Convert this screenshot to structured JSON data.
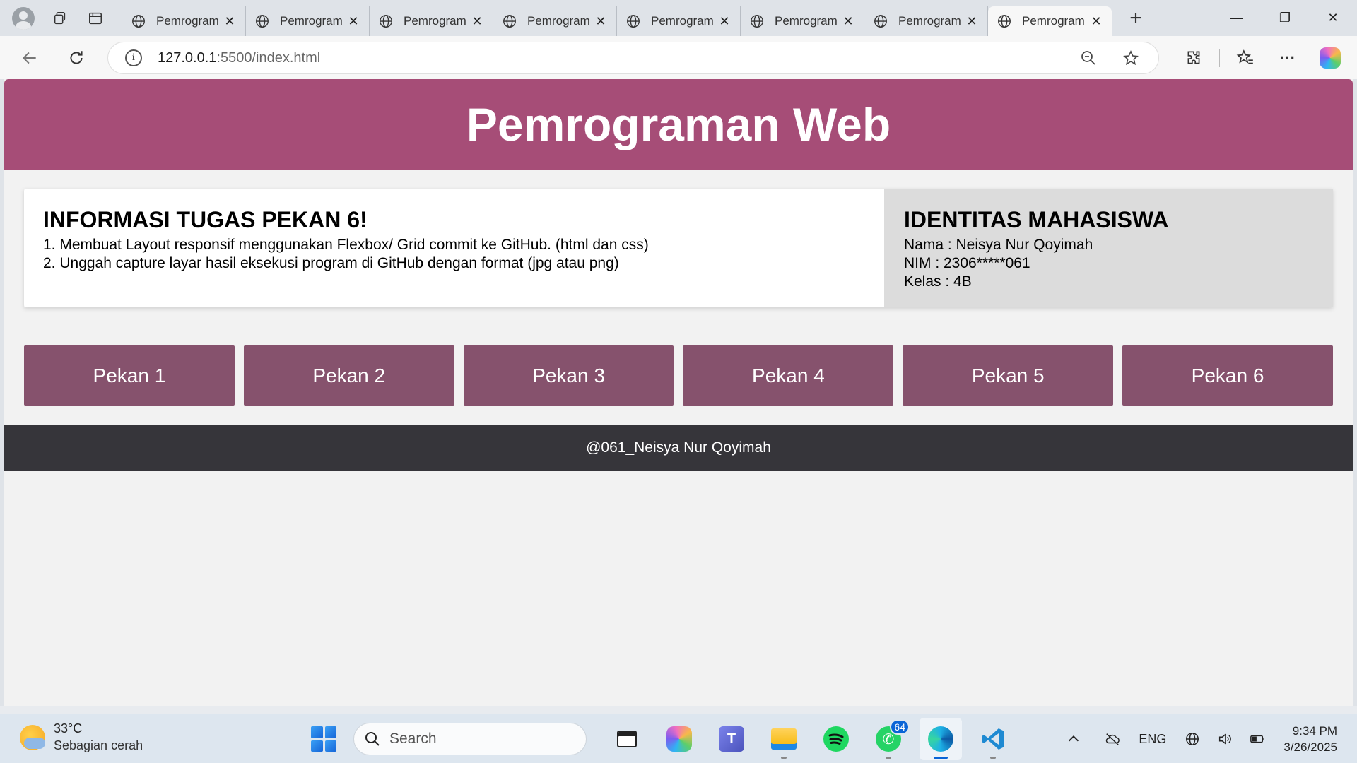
{
  "browser": {
    "tabs": [
      {
        "title": "Pemrograman Web"
      },
      {
        "title": "Pemrograman Web"
      },
      {
        "title": "Pemrograman Web"
      },
      {
        "title": "Pemrograman Web"
      },
      {
        "title": "Pemrograman Web"
      },
      {
        "title": "Pemrograman Web"
      },
      {
        "title": "Pemrograman Web"
      },
      {
        "title": "Pemrograman Web"
      }
    ],
    "url_host": "127.0.0.1",
    "url_rest": ":5500/index.html",
    "icons": [
      "profile-icon",
      "workspaces-icon",
      "tab-actions-icon",
      "back-icon",
      "refresh-icon",
      "info-icon",
      "zoom-out-icon",
      "favorite-star-icon",
      "extensions-icon",
      "favorites-icon",
      "more-icon",
      "copilot-icon"
    ]
  },
  "page": {
    "title": "Pemrograman Web",
    "info": {
      "heading": "INFORMASI TUGAS PEKAN 6!",
      "items": [
        "1. Membuat Layout responsif menggunakan Flexbox/ Grid commit ke GitHub. (html dan css)",
        "2. Unggah capture layar hasil eksekusi program di GitHub dengan format (jpg atau png)"
      ]
    },
    "identity": {
      "heading": "IDENTITAS MAHASISWA",
      "lines": [
        "Nama : Neisya Nur Qoyimah",
        "NIM : 2306*****061",
        "Kelas : 4B"
      ]
    },
    "weeks": [
      "Pekan 1",
      "Pekan 2",
      "Pekan 3",
      "Pekan 4",
      "Pekan 5",
      "Pekan 6"
    ],
    "footer": "@061_Neisya Nur Qoyimah",
    "colors": {
      "header": "#a64d77",
      "week_button": "#86526d",
      "footer": "#36353a"
    }
  },
  "taskbar": {
    "weather_temp": "33°C",
    "weather_condition": "Sebagian cerah",
    "search_placeholder": "Search",
    "whatsapp_badge": "64",
    "language": "ENG",
    "time": "9:34 PM",
    "date": "3/26/2025"
  }
}
